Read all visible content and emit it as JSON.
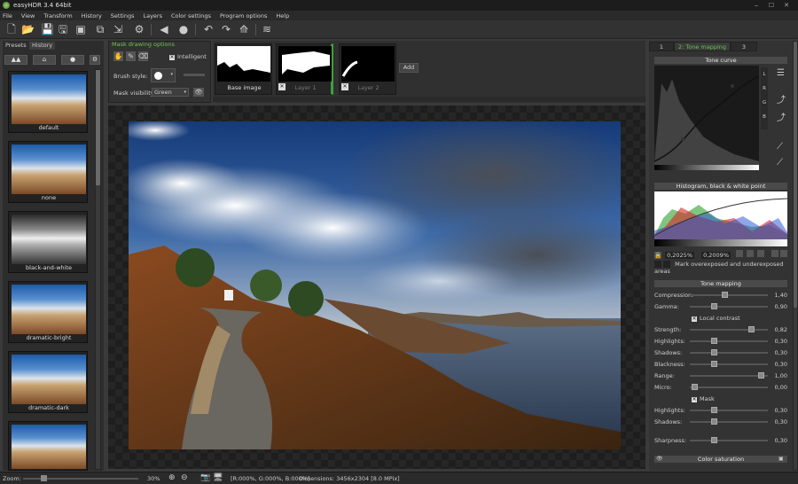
{
  "window": {
    "title": "easyHDR 3.4  64bit",
    "minimize": "‒",
    "maximize": "☐",
    "close": "✕"
  },
  "menu": [
    "File",
    "View",
    "Transform",
    "History",
    "Settings",
    "Layers",
    "Color settings",
    "Program options",
    "Help"
  ],
  "left_panel": {
    "tabs": [
      "Presets",
      "History"
    ],
    "presets": [
      "default",
      "none",
      "black-and-white",
      "dramatic-bright",
      "dramatic-dark",
      ""
    ]
  },
  "mask_options": {
    "title": "Mask drawing options",
    "intelligent_label": "Intelligent",
    "brush_style_label": "Brush style:",
    "mask_visibility_label": "Mask visibility:",
    "mask_visibility_value": "Green"
  },
  "layers": {
    "items": [
      "Base image",
      "Layer 1",
      "Layer 2"
    ],
    "add_label": "Add"
  },
  "status": {
    "zoom_label": "Zoom:",
    "zoom_value": "30%",
    "rgb": "[R:000%, G:000%, B:000%]",
    "dimensions": "Dimensions: 3456x2304 [8.0 MPix]"
  },
  "right_panel": {
    "tabs": [
      "1",
      "2: Tone mapping",
      "3"
    ],
    "tone_curve_title": "Tone curve",
    "curve_channels": [
      "L",
      "R",
      "G",
      "B"
    ],
    "histogram_title": "Histogram, black & white point",
    "black_point": "0,2025%",
    "white_point": "0,2009%",
    "overexposed_label": "Mark overexposed and underexposed areas",
    "tone_mapping_title": "Tone mapping",
    "compression": {
      "label": "Compression:",
      "value": "1,40",
      "level": 0.45
    },
    "gamma": {
      "label": "Gamma:",
      "value": "0,90",
      "level": 0.3
    },
    "local_contrast_label": "Local contrast",
    "sliders": [
      {
        "label": "Strength:",
        "value": "0,82",
        "level": 0.82
      },
      {
        "label": "Highlights:",
        "value": "0,30",
        "level": 0.3
      },
      {
        "label": "Shadows:",
        "value": "0,30",
        "level": 0.3
      },
      {
        "label": "Blackness:",
        "value": "0,30",
        "level": 0.3
      },
      {
        "label": "Range:",
        "value": "1,00",
        "level": 0.95
      },
      {
        "label": "Micro:",
        "value": "0,00",
        "level": 0.02
      }
    ],
    "mask_label": "Mask",
    "mask_sliders": [
      {
        "label": "Highlights:",
        "value": "0,30",
        "level": 0.3
      },
      {
        "label": "Shadows:",
        "value": "0,30",
        "level": 0.3
      },
      {
        "label": "Sharpness:",
        "value": "0,30",
        "level": 0.3
      }
    ],
    "color_saturation_title": "Color saturation"
  },
  "colors": {
    "accent": "#3aa53a",
    "header": "#4a4a4a",
    "panel": "#333333"
  }
}
